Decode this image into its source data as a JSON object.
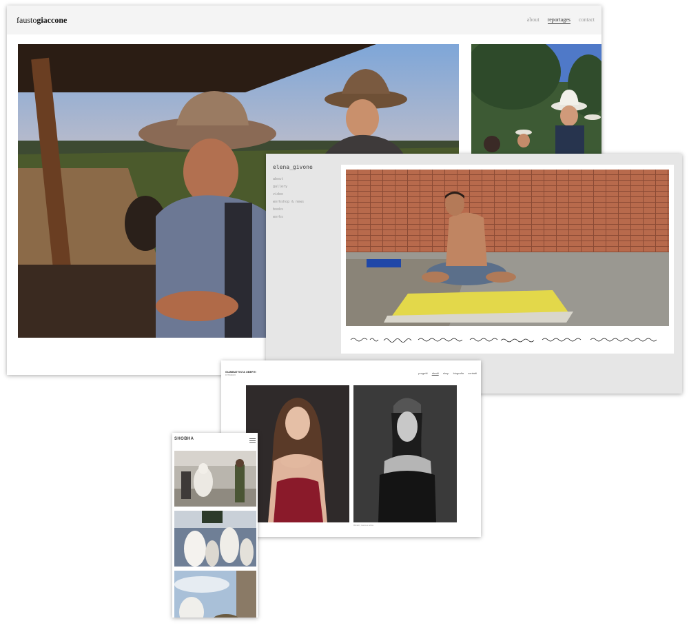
{
  "fausto": {
    "logo_light": "fausto",
    "logo_bold": "giaccone",
    "nav": [
      "about",
      "reportages",
      "contact"
    ]
  },
  "elena": {
    "name": "elena_givone",
    "menu": [
      "about",
      "gallery",
      "video",
      "workshop & news",
      "books",
      "works"
    ]
  },
  "uberti": {
    "brand": "GIAMBATTISTA UBERTI",
    "subtitle": "FOTOGRAFO",
    "nav": [
      "progetti",
      "ritratti",
      "shop",
      "biografia",
      "contatti"
    ],
    "caption": "Ritratti | Laura e anna"
  },
  "shobha": {
    "logo": "SHOBHA"
  },
  "colors": {
    "page_bg": "#ffffff",
    "header_bg": "#f4f4f4",
    "elena_bg": "#e6e6e6"
  }
}
